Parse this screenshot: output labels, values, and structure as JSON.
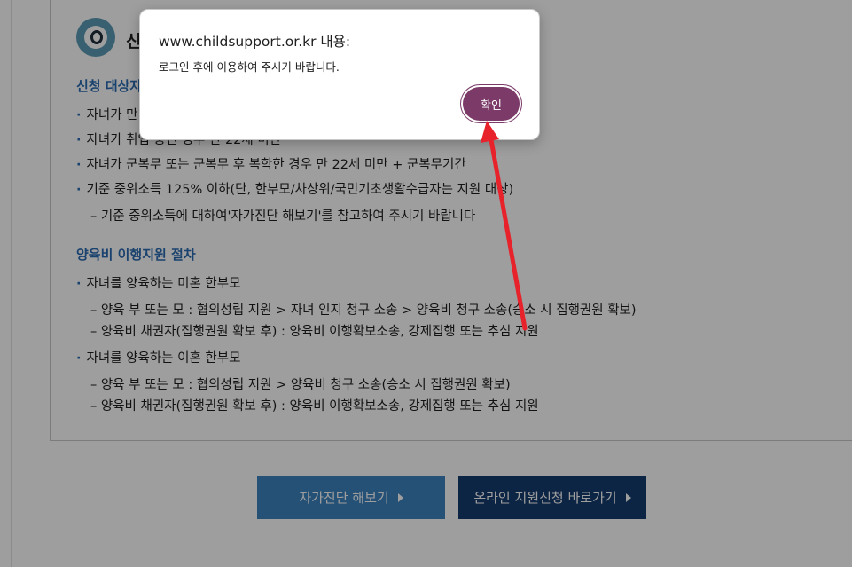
{
  "content": {
    "intro_title": "신",
    "section1_title": "신청 대상자",
    "bullets1": [
      "자녀가 만 1",
      "자녀가 취업 중인 경우 만 22세 미만",
      "자녀가 군복무 또는 군복무 후 복학한 경우 만 22세 미만 + 군복무기간",
      "기준 중위소득 125% 이하(단, 한부모/차상위/국민기초생활수급자는 지원 대상)"
    ],
    "sub1": "– 기준 중위소득에 대하여'자가진단 해보기'를 참고하여 주시기 바랍니다",
    "section2_title": "양육비 이행지원 절차",
    "group1_title": "자녀를 양육하는 미혼 한부모",
    "group1_items": [
      "– 양육 부 또는 모 : 협의성립 지원 > 자녀 인지 청구 소송 > 양육비 청구 소송(승소 시 집행권원 확보)",
      "– 양육비 채권자(집행권원 확보 후) : 양육비 이행확보소송, 강제집행 또는 추심 지원"
    ],
    "group2_title": "자녀를 양육하는 이혼 한부모",
    "group2_items": [
      "– 양육 부 또는 모 : 협의성립 지원 > 양육비 청구 소송(승소 시 집행권원 확보)",
      "– 양육비 채권자(집행권원 확보 후) : 양육비 이행확보소송, 강제집행 또는 추심 지원"
    ]
  },
  "buttons": {
    "self_check": "자가진단 해보기",
    "online_apply": "온라인 지원신청 바로가기"
  },
  "dialog": {
    "title": "www.childsupport.or.kr 내용:",
    "message": "로그인 후에 이용하여 주시기 바랍니다.",
    "ok_label": "확인"
  },
  "colors": {
    "accent_blue": "#2a6bb2",
    "dialog_button": "#7b3a68",
    "annotation_arrow": "#e8222b"
  }
}
